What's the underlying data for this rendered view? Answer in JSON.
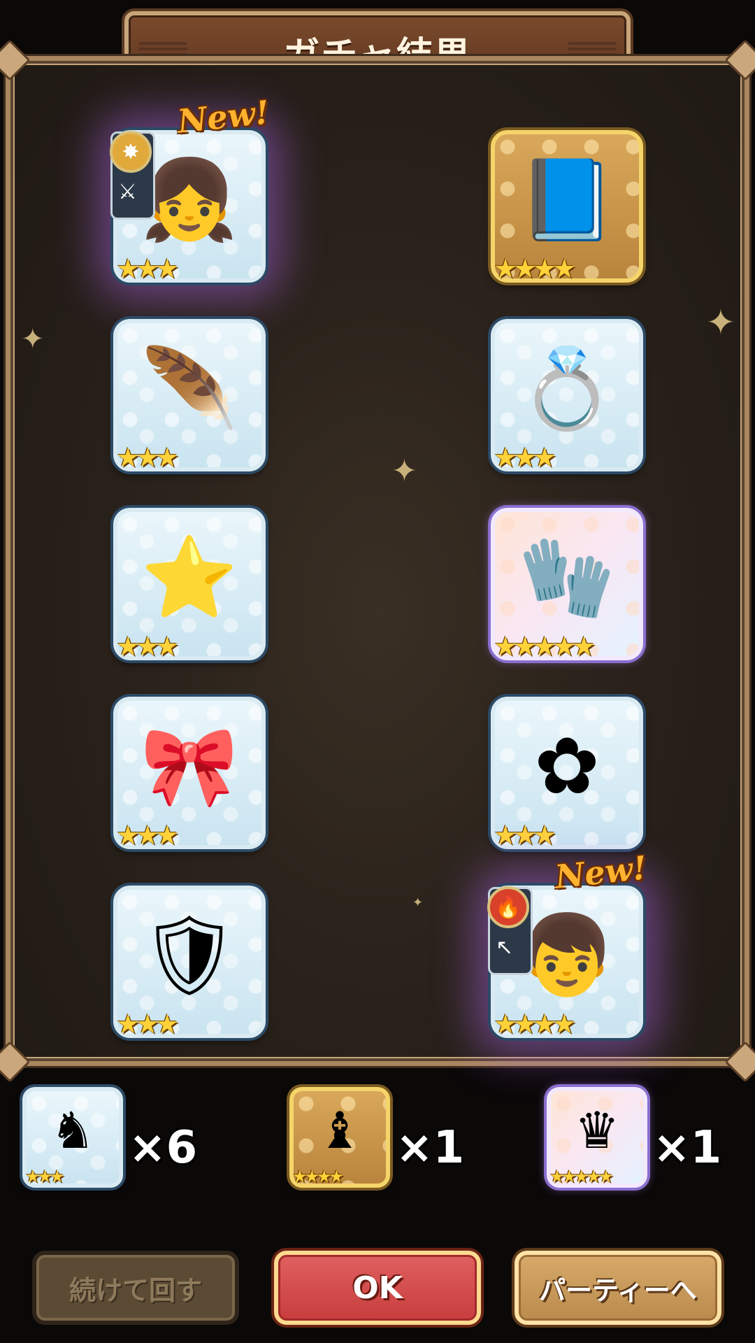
{
  "title": "ガチャ結果",
  "new_label": "New!",
  "results": [
    {
      "name": "character-blonde-fighter",
      "icon": "character-portrait-icon",
      "glyph": "👧",
      "stars": "★★★",
      "frame": "blue",
      "is_new": true,
      "element_icon": "light-element-icon",
      "role_icon": "crossed-swords-icon"
    },
    {
      "name": "blue-tome",
      "icon": "book-icon",
      "glyph": "📘",
      "stars": "★★★★",
      "frame": "gold",
      "is_new": false
    },
    {
      "name": "feather-necklace",
      "icon": "feather-necklace-icon",
      "glyph": "🪶",
      "stars": "★★★",
      "frame": "blue",
      "is_new": false
    },
    {
      "name": "amethyst-ring",
      "icon": "ring-icon",
      "glyph": "💍",
      "stars": "★★★",
      "frame": "blue",
      "is_new": false
    },
    {
      "name": "star-charm",
      "icon": "star-charm-icon",
      "glyph": "⭐",
      "stars": "★★★",
      "frame": "blue",
      "is_new": false
    },
    {
      "name": "white-gauntlet",
      "icon": "glove-icon",
      "glyph": "🧤",
      "stars": "★★★★★",
      "frame": "rainbow",
      "is_new": false
    },
    {
      "name": "red-ribbon",
      "icon": "bow-icon",
      "glyph": "🎀",
      "stars": "★★★",
      "frame": "blue",
      "is_new": false
    },
    {
      "name": "flower-hairpin",
      "icon": "hairpin-icon",
      "glyph": "✿",
      "stars": "★★★",
      "frame": "blue",
      "is_new": false
    },
    {
      "name": "purple-gem-bracer",
      "icon": "bracer-icon",
      "glyph": "🛡",
      "stars": "★★★",
      "frame": "blue",
      "is_new": false
    },
    {
      "name": "character-red-haired-archer",
      "icon": "character-portrait-icon",
      "glyph": "👦",
      "stars": "★★★★",
      "frame": "blue",
      "is_new": true,
      "element_icon": "fire-element-icon",
      "role_icon": "arrow-icon"
    }
  ],
  "rewards": [
    {
      "name": "silver-statue",
      "icon": "silver-statue-icon",
      "glyph": "♞",
      "stars": "★★★",
      "frame": "blue",
      "count": "×6"
    },
    {
      "name": "winged-statue",
      "icon": "winged-statue-icon",
      "glyph": "♝",
      "stars": "★★★★",
      "frame": "gold",
      "count": "×1"
    },
    {
      "name": "golden-statue",
      "icon": "golden-statue-icon",
      "glyph": "♛",
      "stars": "★★★★★",
      "frame": "rainbow",
      "count": "×1"
    }
  ],
  "buttons": {
    "continue": "続けて回す",
    "ok": "OK",
    "party": "パーティーへ"
  },
  "colors": {
    "panel_border": "#a9875f",
    "ok_button": "#c83d3d",
    "party_button": "#b98a4c",
    "new_label": "#ffb22e"
  }
}
